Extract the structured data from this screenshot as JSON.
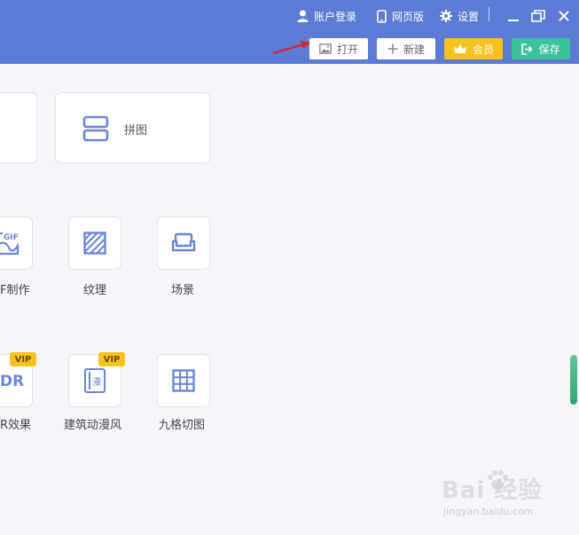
{
  "header": {
    "login_label": "账户登录",
    "web_label": "网页版",
    "settings_label": "设置"
  },
  "toolbar": {
    "open_label": "打开",
    "new_label": "新建",
    "vip_label": "会员",
    "save_label": "保存"
  },
  "colors": {
    "titlebar": "#5b7bd5",
    "accent_icon": "#6a86d6",
    "vip_yellow": "#f7c21b",
    "save_green": "#3cc19a",
    "arrow_red": "#e02020"
  },
  "cards": {
    "puzzle_label": "拼图"
  },
  "tools_row1": {
    "gif_icon_text": "GIF",
    "gif_label": "F制作",
    "texture_label": "纹理",
    "scene_label": "场景"
  },
  "tools_row2": {
    "hdr_icon_text": "DR",
    "hdr_label": "R效果",
    "hdr_badge": "VIP",
    "anime_icon_text": "漫",
    "anime_label": "建筑动漫风",
    "anime_badge": "VIP",
    "grid_label": "九格切图"
  },
  "watermark": {
    "main": "Bai  经验",
    "sub": "jingyan.baidu.com"
  }
}
